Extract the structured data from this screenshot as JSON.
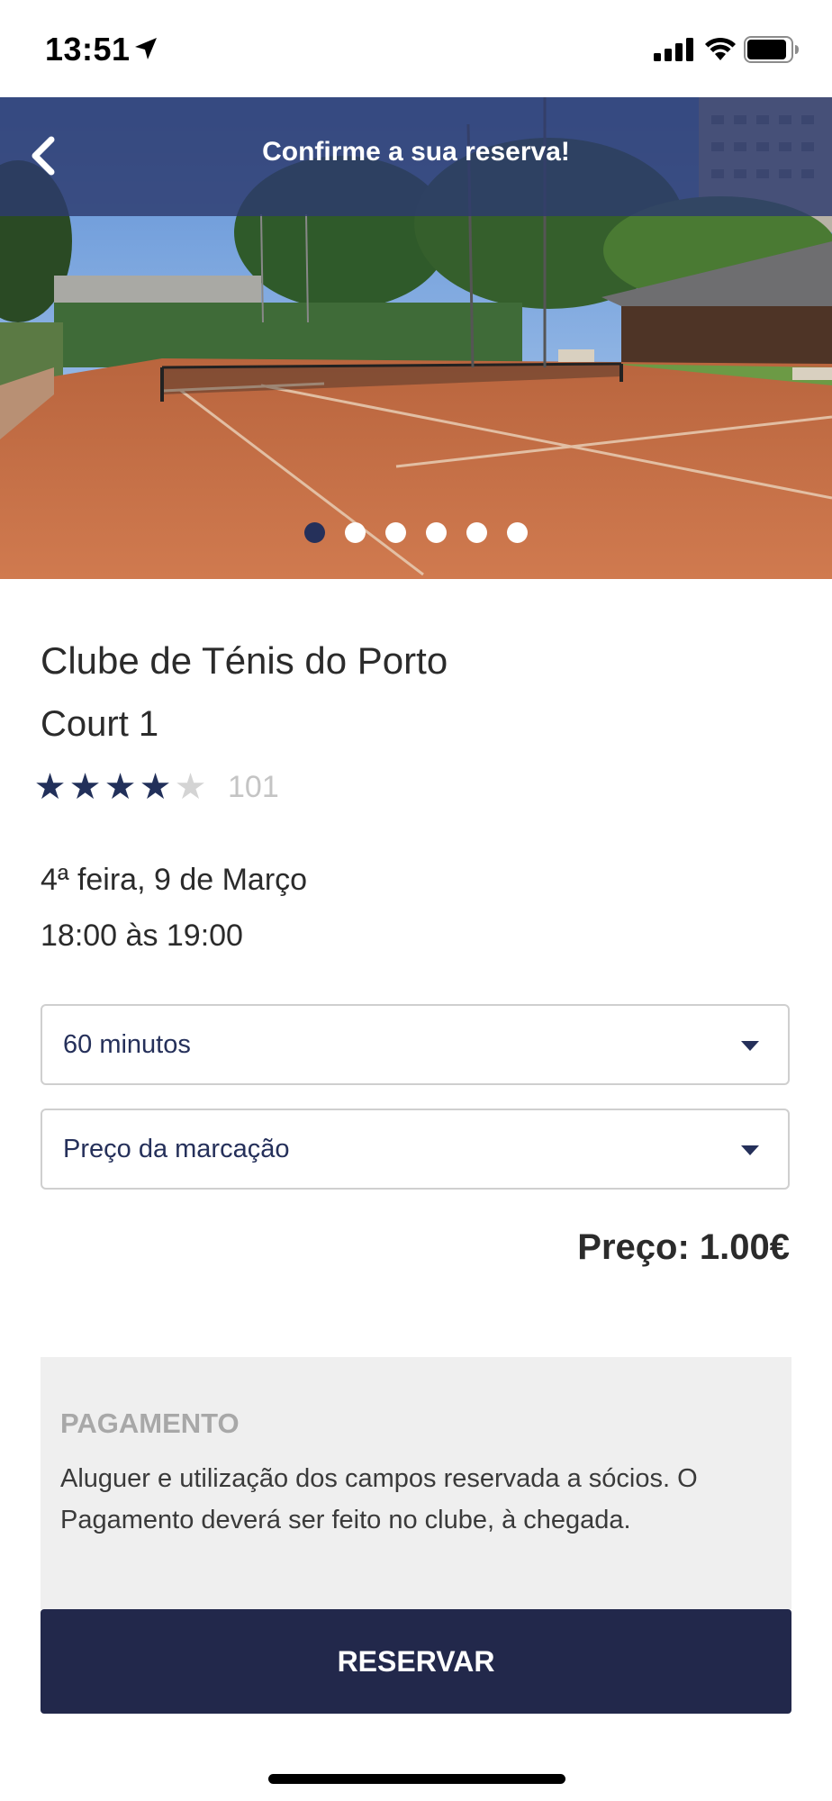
{
  "status_bar": {
    "time": "13:51"
  },
  "header": {
    "title": "Confirme a sua reserva!"
  },
  "carousel": {
    "slides": 6,
    "active_index": 0
  },
  "club": {
    "name": "Clube de Ténis do Porto",
    "court": "Court 1",
    "rating": {
      "stars": 4,
      "max": 5,
      "count": "101"
    }
  },
  "booking": {
    "date": "4ª feira, 9 de Março",
    "time": "18:00 às 19:00",
    "duration_select": "60 minutos",
    "price_select": "Preço da marcação",
    "price": "Preço: 1.00€"
  },
  "payment": {
    "title": "PAGAMENTO",
    "text": "Aluguer e utilização dos campos reservada a sócios. O Pagamento deverá ser feito no clube, à chegada."
  },
  "actions": {
    "reserve_label": "RESERVAR"
  },
  "colors": {
    "accent": "#22284b",
    "header_overlay": "#2d3a6e",
    "clay": "#c8673f"
  }
}
